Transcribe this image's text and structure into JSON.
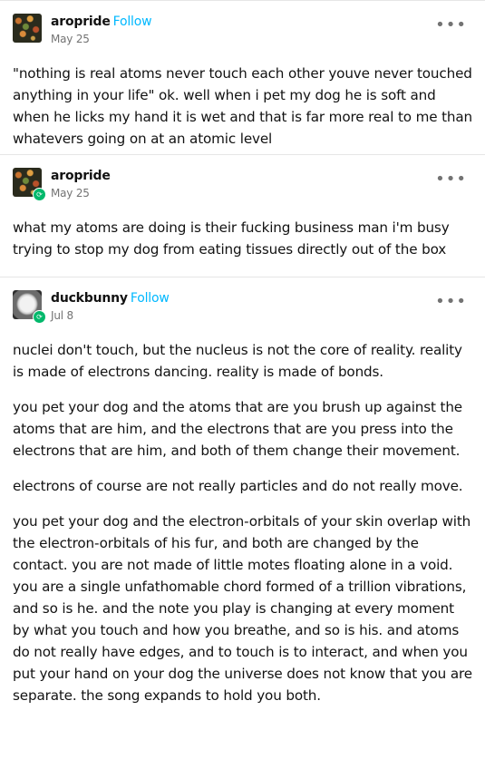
{
  "posts": [
    {
      "username": "aropride",
      "follow_label": "Follow",
      "date": "May 25",
      "avatar": "flowers-avatar",
      "reblogged": false,
      "paragraphs": [
        "\"nothing is real atoms never touch each other youve never touched anything in your life\" ok. well when i pet my dog he is soft and when he licks my hand it is wet and that is far more real to me than whatevers going on at an atomic level"
      ]
    },
    {
      "username": "aropride",
      "date": "May 25",
      "avatar": "flowers-avatar",
      "reblogged": true,
      "paragraphs": [
        "what my atoms are doing is their fucking business man i'm busy trying to stop my dog from eating tissues directly out of the box"
      ]
    },
    {
      "username": "duckbunny",
      "follow_label": "Follow",
      "date": "Jul 8",
      "avatar": "duck-avatar",
      "reblogged": true,
      "paragraphs": [
        "nuclei don't touch, but the nucleus is not the core of reality. reality is made of electrons dancing. reality is made of bonds.",
        "you pet your dog and the atoms that are you brush up against the atoms that are him, and the electrons that are you press into the electrons that are him, and both of them change their movement.",
        "electrons of course are not really particles and do not really move.",
        "you pet your dog and the electron-orbitals of your skin overlap with the electron-orbitals of his fur, and both are changed by the contact. you are not made of little motes floating alone in a void. you are a single unfathomable chord formed of a trillion vibrations, and so is he. and the note you play is changing at every moment by what you touch and how you breathe, and so is his. and atoms do not really have edges, and to touch is to interact, and when you put your hand on your dog the universe does not know that you are separate. the song expands to hold you both."
      ]
    }
  ],
  "icons": {
    "more": "•••",
    "reblog": "⟳"
  }
}
